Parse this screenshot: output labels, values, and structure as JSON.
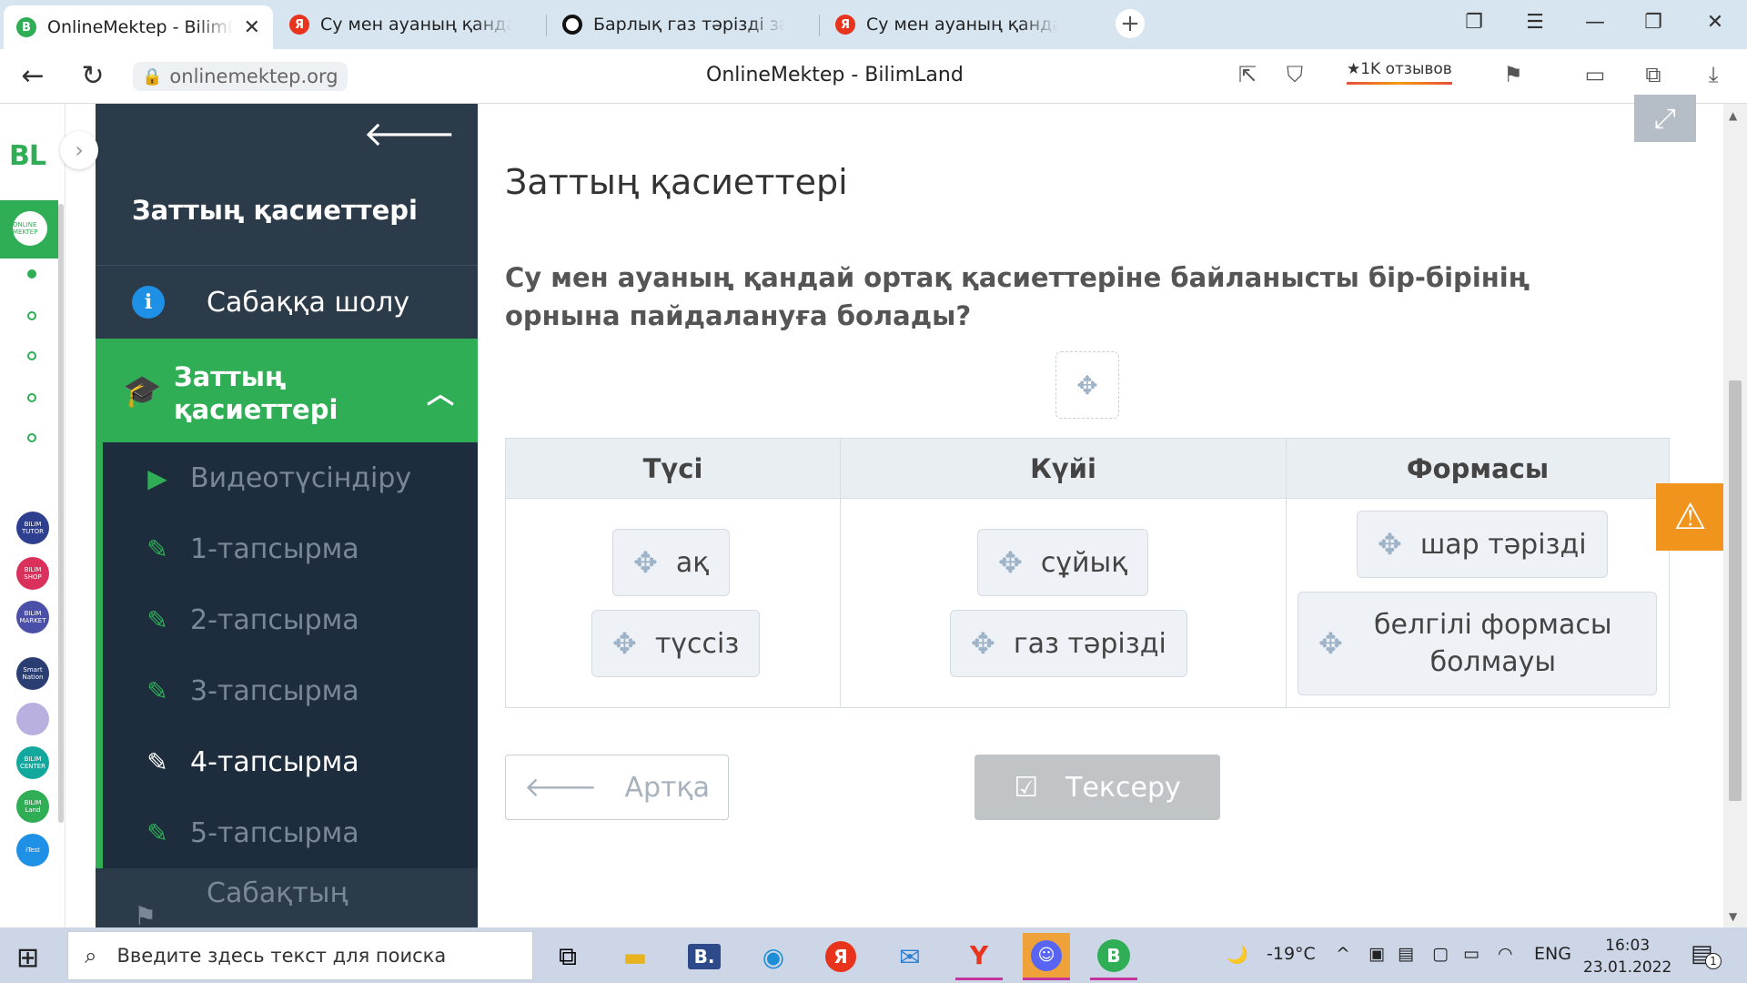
{
  "browser": {
    "tabs": [
      {
        "title": "OnlineMektep - BilimLand",
        "icon": "bilimland-icon"
      },
      {
        "title": "Су мен ауаның қандай ортақ",
        "icon": "yandex-icon"
      },
      {
        "title": "Барлық газ тәрізді затқа о",
        "icon": "opera-icon"
      },
      {
        "title": "Су мен ауаның қандай ортақ",
        "icon": "yandex-icon"
      }
    ],
    "url": "onlinemektep.org",
    "page_title": "OnlineMektep - BilimLand",
    "reviews": "★1K отзывов"
  },
  "lesson": {
    "title": "Заттың қасиеттері",
    "overview": "Сабаққа шолу",
    "section": "Заттың қасиеттері",
    "items": [
      {
        "label": "Видеотүсіндіру",
        "icon": "play-icon"
      },
      {
        "label": "1-тапсырма",
        "icon": "edit-icon"
      },
      {
        "label": "2-тапсырма",
        "icon": "edit-icon"
      },
      {
        "label": "3-тапсырма",
        "icon": "edit-icon"
      },
      {
        "label": "4-тапсырма",
        "icon": "edit-icon"
      },
      {
        "label": "5-тапсырма",
        "icon": "edit-icon"
      }
    ],
    "current_item": "4-тапсырма",
    "footer": "Сабақтың"
  },
  "task": {
    "heading": "Заттың қасиеттері",
    "question": "Су мен ауаның қандай ортақ қасиеттеріне байланысты бір-бірінің орнына пайдалануға болады?",
    "columns": [
      {
        "header": "Түсі",
        "chips": [
          "ақ",
          "түссіз"
        ]
      },
      {
        "header": "Күйі",
        "chips": [
          "сұйық",
          "газ тәрізді"
        ]
      },
      {
        "header": "Формасы",
        "chips": [
          "шар тәрізді",
          "белгілі формасы болмауы"
        ]
      }
    ],
    "back_button": "Артқа",
    "check_button": "Тексеру"
  },
  "rail_apps": [
    {
      "label": "ONLINE MEKTEP",
      "color": "#2fae56"
    },
    {
      "label": "BILIM TUTOR",
      "color": "#2e3f8f"
    },
    {
      "label": "BILIM SHOP",
      "color": "#d9315b"
    },
    {
      "label": "BILIM MARKET",
      "color": "#4a4fa8"
    },
    {
      "label": "Smart Nation",
      "color": "#2b3e73"
    },
    {
      "label": "",
      "color": "#b9b0e0"
    },
    {
      "label": "BILIM CENTER",
      "color": "#13a89e"
    },
    {
      "label": "BILIM Land",
      "color": "#2fae56"
    },
    {
      "label": "iTest",
      "color": "#1e90e6"
    }
  ],
  "taskbar": {
    "search_placeholder": "Введите здесь текст для поиска",
    "temperature": "-19°C",
    "language": "ENG",
    "time": "16:03",
    "date": "23.01.2022",
    "notifications": "1"
  }
}
